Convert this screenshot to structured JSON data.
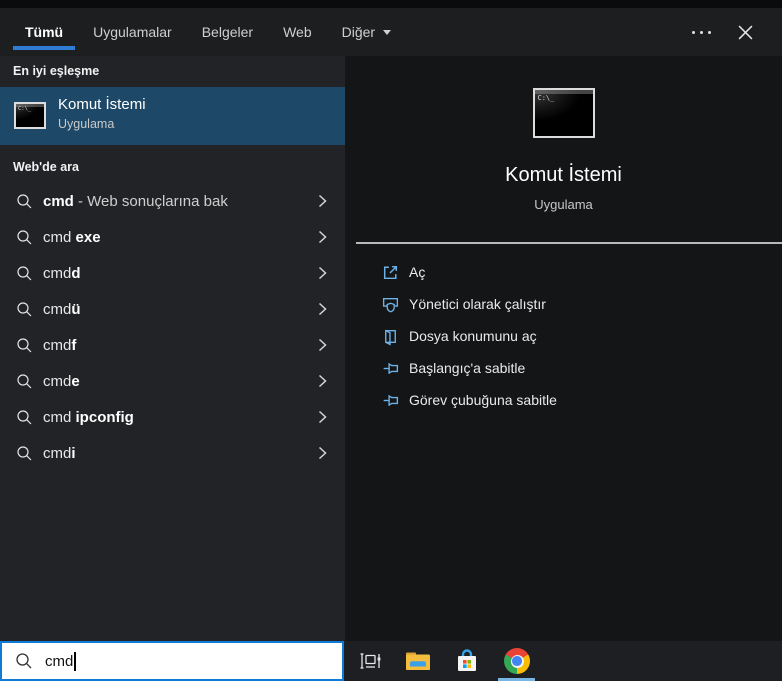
{
  "header": {
    "tabs": [
      {
        "label": "Tümü",
        "selected": true
      },
      {
        "label": "Uygulamalar",
        "selected": false
      },
      {
        "label": "Belgeler",
        "selected": false
      },
      {
        "label": "Web",
        "selected": false
      },
      {
        "label": "Diğer",
        "selected": false,
        "has_dropdown": true
      }
    ],
    "icons": {
      "more": "ellipsis-icon",
      "close": "close-icon",
      "dropdown": "chevron-down-icon"
    }
  },
  "left": {
    "best_match_header": "En iyi eşleşme",
    "best_match": {
      "title": "Komut İstemi",
      "type": "Uygulama",
      "icon": "command-prompt-icon",
      "highlighted": true
    },
    "web_header": "Web'de ara",
    "suggestions": [
      {
        "pre": "",
        "em": "cmd",
        "post": " - Web sonuçlarına bak"
      },
      {
        "pre": "cmd ",
        "em": "exe",
        "post": ""
      },
      {
        "pre": "cmd",
        "em": "d",
        "post": ""
      },
      {
        "pre": "cmd",
        "em": "ü",
        "post": ""
      },
      {
        "pre": "cmd",
        "em": "f",
        "post": ""
      },
      {
        "pre": "cmd",
        "em": "e",
        "post": ""
      },
      {
        "pre": "cmd ",
        "em": "ipconfig",
        "post": ""
      },
      {
        "pre": "cmd",
        "em": "i",
        "post": ""
      }
    ],
    "row_icons": {
      "left": "search-icon",
      "right": "chevron-right-icon"
    }
  },
  "preview": {
    "title": "Komut İstemi",
    "type": "Uygulama",
    "icon": "command-prompt-icon",
    "actions": [
      {
        "label": "Aç",
        "icon": "open-icon"
      },
      {
        "label": "Yönetici olarak çalıştır",
        "icon": "run-as-admin-icon"
      },
      {
        "label": "Dosya konumunu aç",
        "icon": "file-location-icon"
      },
      {
        "label": "Başlangıç'a sabitle",
        "icon": "pin-to-start-icon"
      },
      {
        "label": "Görev çubuğuna sabitle",
        "icon": "pin-to-taskbar-icon"
      }
    ]
  },
  "search": {
    "value": "cmd",
    "icon": "search-icon"
  },
  "app_icon": {
    "prompt_text": "C:\\_"
  },
  "taskbar": {
    "buttons": [
      "task-view",
      "file-explorer",
      "microsoft-store",
      "google-chrome"
    ],
    "active_button": "google-chrome"
  },
  "colors": {
    "accent_underline": "#2e7dd3",
    "best_match_highlight": "#1d4868",
    "action_icon_blue": "#6cb2e8",
    "search_border": "#0f7bd7",
    "taskbar_active_underline": "#76b5e4"
  }
}
